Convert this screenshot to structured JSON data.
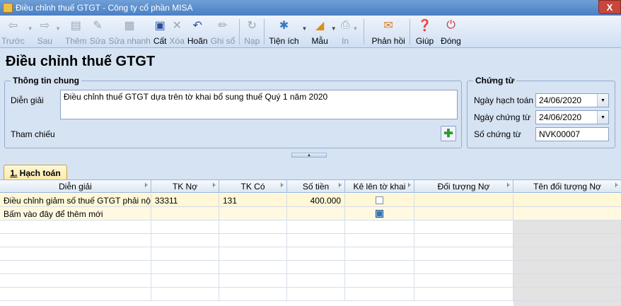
{
  "window": {
    "title": "Điều chỉnh thuế GTGT - Công ty cổ phần MISA",
    "close_glyph": "X"
  },
  "toolbar": {
    "items": [
      {
        "label": "Trước",
        "enabled": false
      },
      {
        "label": "Sau",
        "enabled": false
      },
      {
        "label": "Thêm",
        "enabled": false
      },
      {
        "label": "Sửa",
        "enabled": false
      },
      {
        "label": "Sửa nhanh",
        "enabled": false
      },
      {
        "label": "Cất",
        "enabled": true
      },
      {
        "label": "Xóa",
        "enabled": false
      },
      {
        "label": "Hoãn",
        "enabled": true
      },
      {
        "label": "Ghi sổ",
        "enabled": false
      },
      {
        "label": "Nạp",
        "enabled": false
      },
      {
        "label": "Tiện ích",
        "enabled": true
      },
      {
        "label": "Mẫu",
        "enabled": true
      },
      {
        "label": "In",
        "enabled": false
      },
      {
        "label": "Phản hồi",
        "enabled": true
      },
      {
        "label": "Giúp",
        "enabled": true
      },
      {
        "label": "Đóng",
        "enabled": true
      }
    ]
  },
  "page": {
    "title": "Điều chỉnh thuế GTGT"
  },
  "general": {
    "legend": "Thông tin chung",
    "desc_label": "Diễn giải",
    "desc_value": "Điều chỉnh thuế GTGT dựa trên tờ khai bổ sung thuế Quý 1 năm 2020",
    "ref_label": "Tham chiếu"
  },
  "voucher": {
    "legend": "Chứng từ",
    "posting_date_label": "Ngày hạch toán",
    "posting_date": "24/06/2020",
    "voucher_date_label": "Ngày chứng từ",
    "voucher_date": "24/06/2020",
    "voucher_no_label": "Số chứng từ",
    "voucher_no": "NVK00007"
  },
  "tabs": {
    "accounting_prefix": "1.",
    "accounting_label": " Hạch toán"
  },
  "grid": {
    "headers": [
      "Diễn giải",
      "TK Nợ",
      "TK Có",
      "Số tiền",
      "Kê lên tờ khai",
      "Đối tượng Nợ",
      "Tên đối tượng Nợ"
    ],
    "rows": [
      {
        "desc": "Điều chỉnh giảm số thuế GTGT phải nộ",
        "debit": "33311",
        "credit": "131",
        "amount": "400.000",
        "declare": false
      }
    ],
    "add_row_text": "Bấm vào đây để thêm mới"
  },
  "icons": {
    "back": "arrow-left-icon",
    "next": "arrow-right-icon",
    "add": "document-add-icon",
    "edit": "document-edit-icon",
    "quick_edit": "quick-edit-icon",
    "save": "floppy-disk-icon",
    "delete": "delete-icon",
    "undo": "undo-icon",
    "post": "pencil-icon",
    "load": "load-icon",
    "utilities": "tools-icon",
    "template": "template-icon",
    "print": "printer-icon",
    "feedback": "envelope-icon",
    "help": "help-icon",
    "close": "power-icon"
  }
}
